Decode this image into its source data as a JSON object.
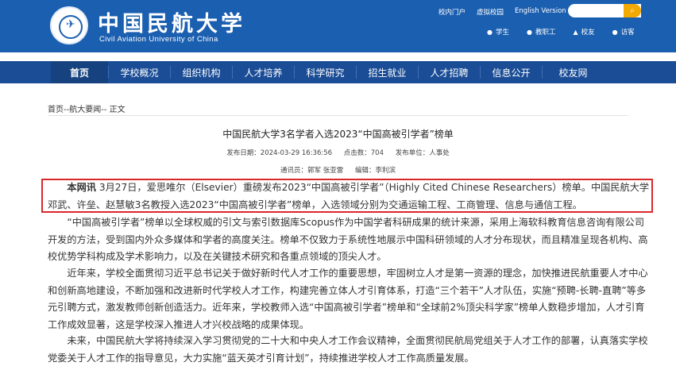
{
  "header": {
    "logo_cn": "中国民航大学",
    "logo_en": "Civil Aviation University of China",
    "top_links": [
      "校内门户",
      "虚拟校园",
      "English Version"
    ],
    "search_placeholder": "",
    "user_links": [
      "学生",
      "教职工",
      "校友",
      "访客"
    ]
  },
  "nav": {
    "items": [
      "首页",
      "学校概况",
      "组织机构",
      "人才培养",
      "科学研究",
      "招生就业",
      "人才招聘",
      "信息公开",
      "校友网"
    ]
  },
  "breadcrumb": {
    "home": "首页",
    "sep": "--",
    "section": "航大要闻",
    "current": "正文"
  },
  "article": {
    "title": "中国民航大学3名学者入选2023“中国高被引学者”榜单",
    "publish_time": "发布日期：2024-03-29 16:36:56",
    "views": "点击数：704",
    "publisher": "发布单位：人事处",
    "correspondent": "通讯员：郭军 张亚雷",
    "editor": "编辑：李利滨",
    "lead_label": "本网讯",
    "p1": "3月27日，爱思唯尔（Elsevier）重磅发布2023“中国高被引学者”（Highly Cited Chinese Researchers）榜单。中国民航大学邓武、许垒、赵慧敏3名教授入选2023“中国高被引学者”榜单，入选领域分别为交通运输工程、工商管理、信息与通信工程。",
    "p2": "“中国高被引学者”榜单以全球权威的引文与索引数据库Scopus作为中国学者科研成果的统计来源，采用上海软科教育信息咨询有限公司开发的方法，受到国内外众多媒体和学者的高度关注。榜单不仅致力于系统性地展示中国科研领域的人才分布现状，而且精准呈现各机构、高校优势学科构成及学术影响力，以及在关键技术研究和各重点领域的顶尖人才。",
    "p3": "近年来，学校全面贯彻习近平总书记关于做好新时代人才工作的重要思想，牢固树立人才是第一资源的理念，加快推进民航重要人才中心和创新高地建设，不断加强和改进新时代学校人才工作，构建完善立体人才引育体系，打造“三个若干”人才队伍，实施“预聘-长聘-直聘”等多元引聘方式，激发教师创新创造活力。近年来，学校教师入选“中国高被引学者”榜单和“全球前2%顶尖科学家”榜单人数稳步增加，人才引育工作成效显著，这是学校深入推进人才兴校战略的成果体现。",
    "p4": "未来，中国民航大学将持续深入学习贯彻党的二十大和中央人才工作会议精神，全面贯彻民航局党组关于人才工作的部署，认真落实学校党委关于人才工作的指导意见，大力实施“蓝天英才引育计划”，持续推进学校人才工作高质量发展。"
  },
  "colors": {
    "header_bg": "#1b5fb0",
    "nav_bg": "#1a4d96",
    "highlight_border": "#d9282b",
    "search_btn": "#f2a900"
  }
}
